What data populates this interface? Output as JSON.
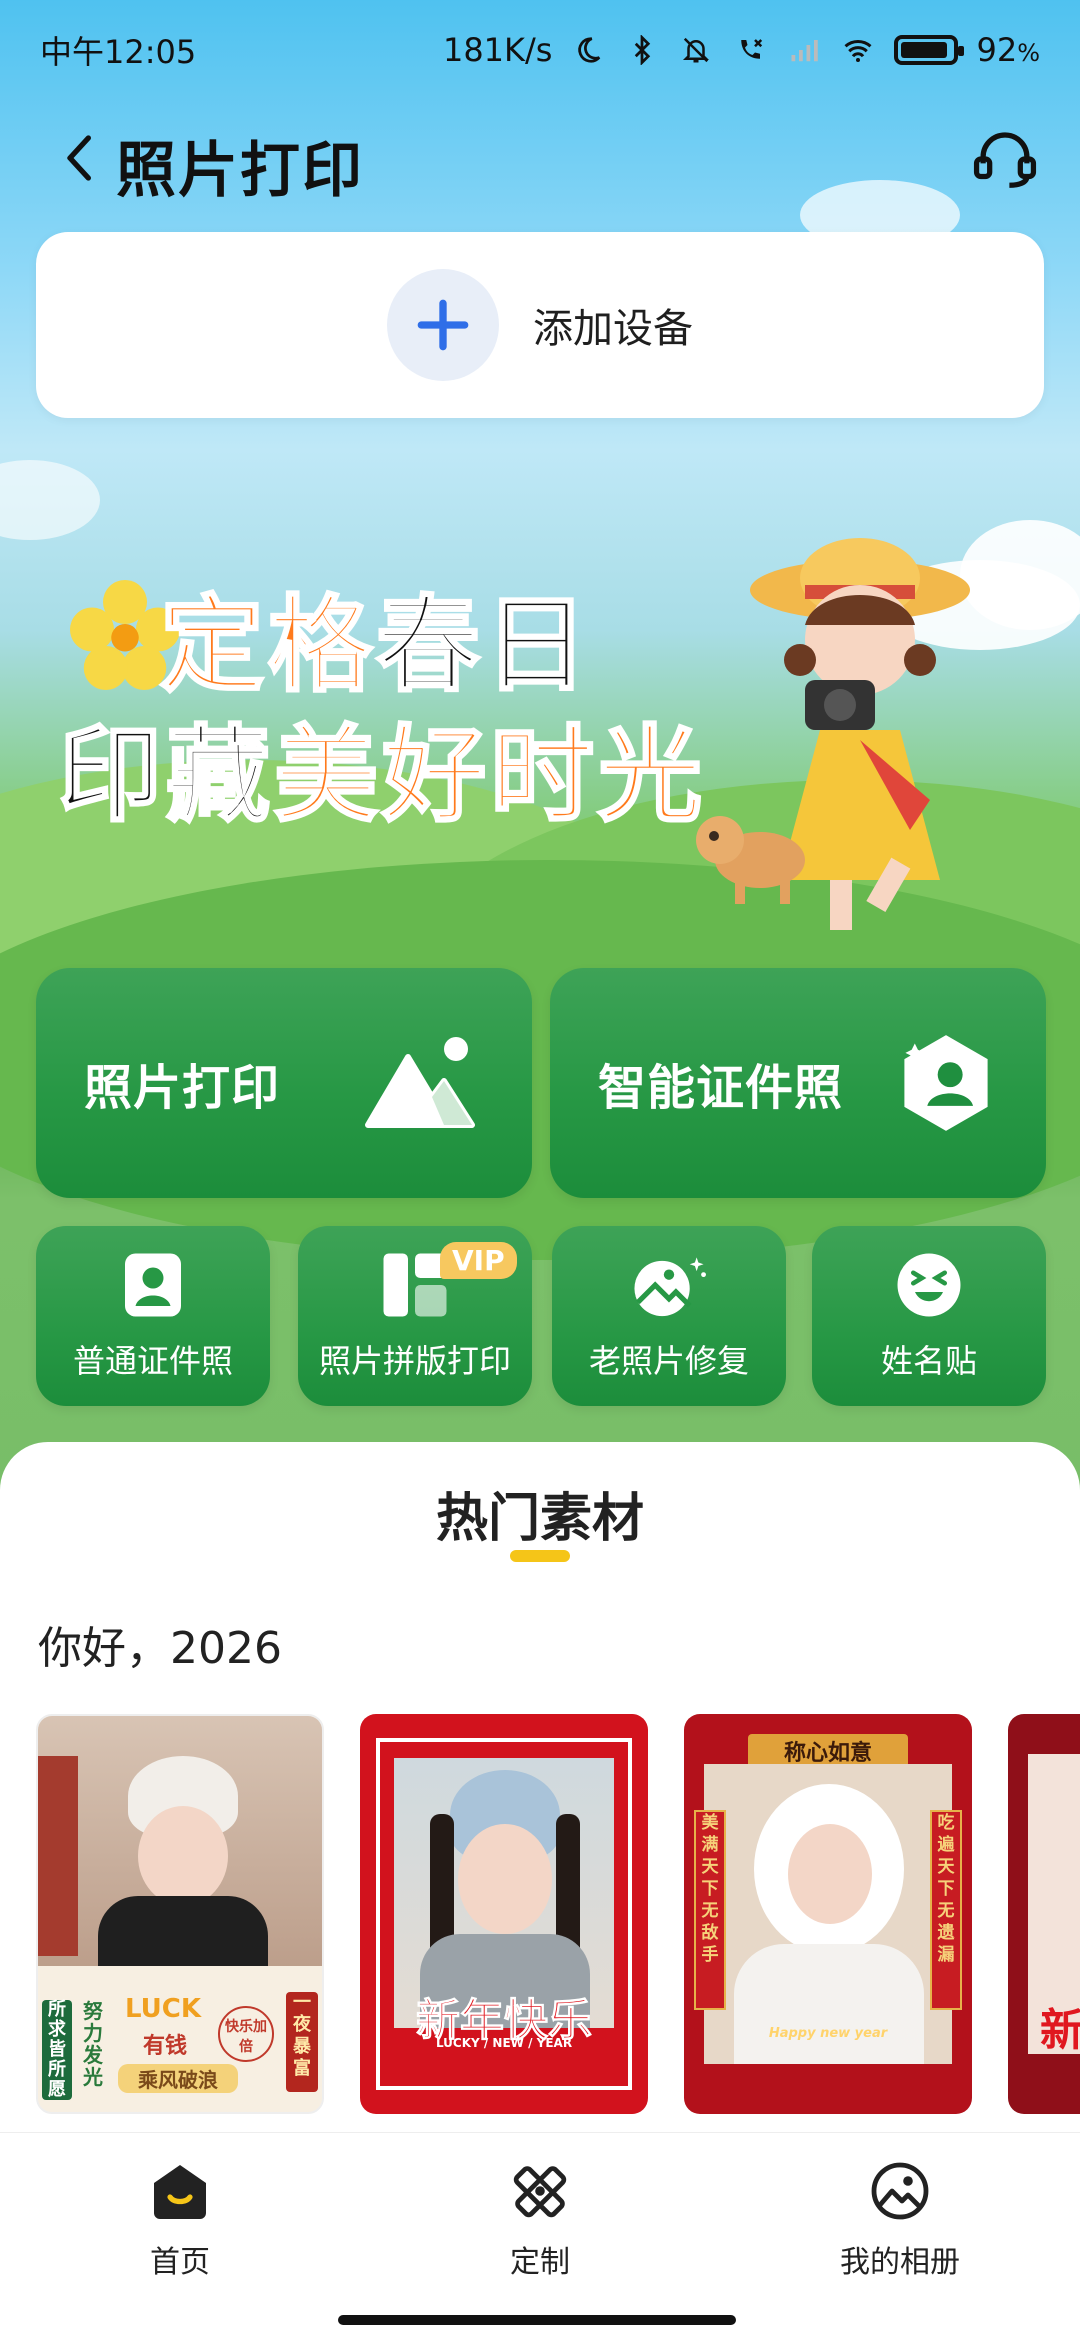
{
  "status_bar": {
    "time": "中午12:05",
    "network_speed": "181K/s",
    "battery_percent": "92",
    "battery_unit": "%",
    "battery_level": 0.92,
    "icons": [
      "moon-icon",
      "bluetooth-icon",
      "mute-bell-icon",
      "call-icon",
      "signal-icon",
      "wifi-icon",
      "battery-icon"
    ]
  },
  "header": {
    "title": "照片打印"
  },
  "add_device": {
    "label": "添加设备"
  },
  "banner": {
    "line1_a": "定格",
    "line1_b": "春日",
    "line2_a": "印藏",
    "line2_b": "美好时光"
  },
  "features": {
    "big": [
      {
        "label": "照片打印",
        "icon": "mountain-photo-icon"
      },
      {
        "label": "智能证件照",
        "icon": "id-photo-hexagon-icon"
      }
    ],
    "small": [
      {
        "label": "普通证件照",
        "icon": "id-card-person-icon"
      },
      {
        "label": "照片拼版打印",
        "icon": "layout-grid-icon",
        "badge": "VIP"
      },
      {
        "label": "老照片修复",
        "icon": "photo-restore-icon"
      },
      {
        "label": "姓名贴",
        "icon": "smile-sticker-icon"
      }
    ]
  },
  "materials": {
    "section_title": "热门素材",
    "group_title": "你好，2026",
    "cards": [
      {
        "stickers": [
          "LUCK",
          "有钱",
          "努力发光",
          "一夜暴富",
          "快乐加倍",
          "乘风破浪",
          "所求皆所愿"
        ]
      },
      {
        "stickers": [
          "新年快乐",
          "LUCKY / NEW / YEAR"
        ]
      },
      {
        "stickers": [
          "称心如意",
          "美满天下无敌手",
          "吃遍天下无遗漏",
          "Happy new year"
        ]
      },
      {
        "stickers": [
          "新"
        ]
      }
    ]
  },
  "bottom_nav": {
    "items": [
      {
        "label": "首页",
        "icon": "home-icon"
      },
      {
        "label": "定制",
        "icon": "customize-icon"
      },
      {
        "label": "我的相册",
        "icon": "album-icon"
      }
    ]
  },
  "colors": {
    "tile_green": "#279845",
    "accent_yellow": "#f5c518",
    "plus_blue": "#2f6ee8"
  }
}
